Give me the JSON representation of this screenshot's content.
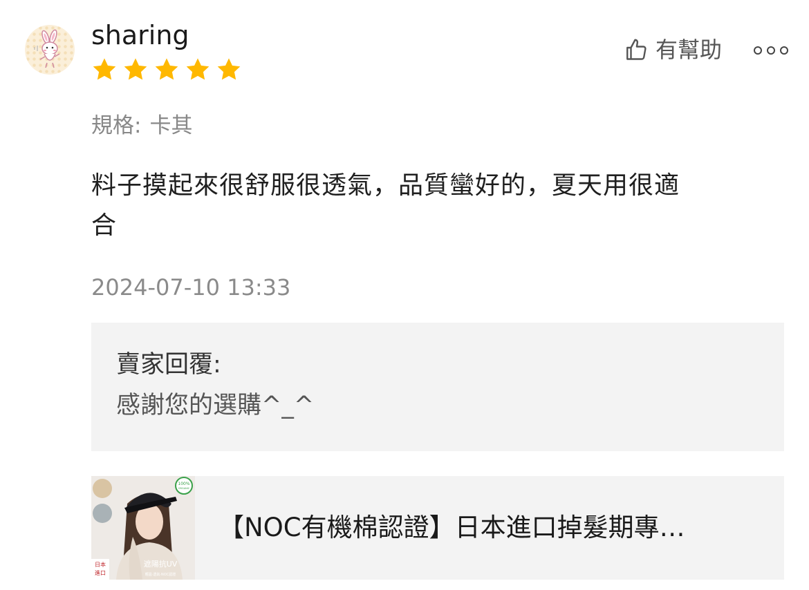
{
  "review": {
    "username": "sharing",
    "rating": 5,
    "rating_max": 5,
    "helpful_label": "有幫助",
    "spec_label": "規格:",
    "spec_value": "卡其",
    "comment_line1": "料子摸起來很舒服很透氣，品質蠻好的，夏天用很適",
    "comment_line2": "合",
    "timestamp": "2024-07-10 13:33"
  },
  "seller_reply": {
    "title": "賣家回覆:",
    "text": "感謝您的選購^_^"
  },
  "product": {
    "title": "【NOC有機棉認證】日本進口掉髮期專…",
    "thumb_badge": "100% ORGANIC",
    "thumb_caption": "遮陽抗UV",
    "thumb_subcaption": "輕盈·透氣·NOC認證",
    "thumb_corner": "日本進口"
  },
  "colors": {
    "star": "#FFB800",
    "reply_bg": "#F3F3F3",
    "muted_text": "#888888"
  },
  "icons": {
    "helpful": "thumbs-up-icon",
    "more": "more-options-icon",
    "star": "star-icon"
  }
}
